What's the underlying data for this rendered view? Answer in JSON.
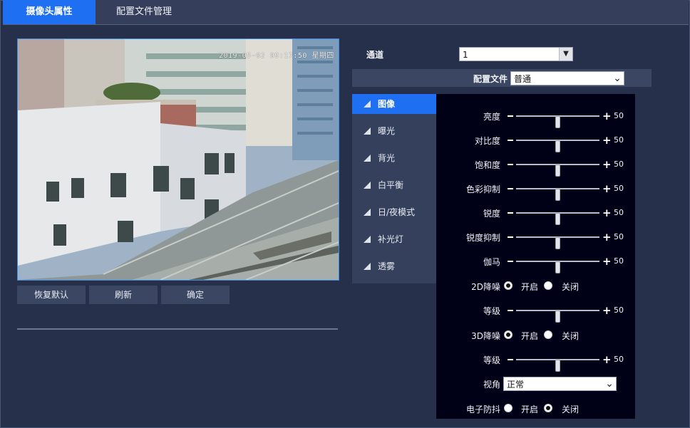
{
  "tabs": [
    {
      "label": "摄像头属性",
      "active": true
    },
    {
      "label": "配置文件管理",
      "active": false
    }
  ],
  "video": {
    "timestamp": "2019-05-02 09:17:50 星期四"
  },
  "buttons": {
    "restore": "恢复默认",
    "refresh": "刷新",
    "confirm": "确定"
  },
  "channel": {
    "label": "通道",
    "value": "1"
  },
  "profile": {
    "label": "配置文件",
    "value": "普通"
  },
  "nav": [
    {
      "label": "图像",
      "active": true
    },
    {
      "label": "曝光",
      "active": false
    },
    {
      "label": "背光",
      "active": false
    },
    {
      "label": "白平衡",
      "active": false
    },
    {
      "label": "日/夜模式",
      "active": false
    },
    {
      "label": "补光灯",
      "active": false
    },
    {
      "label": "透雾",
      "active": false
    }
  ],
  "sliders": {
    "brightness": {
      "label": "亮度",
      "value": 50
    },
    "contrast": {
      "label": "对比度",
      "value": 50
    },
    "saturation": {
      "label": "饱和度",
      "value": 50
    },
    "chroma_suppress": {
      "label": "色彩抑制",
      "value": 50
    },
    "sharpness": {
      "label": "锐度",
      "value": 50
    },
    "sharp_suppress": {
      "label": "锐度抑制",
      "value": 50
    },
    "gamma": {
      "label": "伽马",
      "value": 50
    },
    "nr2d_level": {
      "label": "等级",
      "value": 50
    },
    "nr3d_level": {
      "label": "等级",
      "value": 50
    }
  },
  "radios": {
    "nr2d": {
      "label": "2D降噪",
      "on_label": "开启",
      "off_label": "关闭",
      "selected": "on"
    },
    "nr3d": {
      "label": "3D降噪",
      "on_label": "开启",
      "off_label": "关闭",
      "selected": "on"
    },
    "eis": {
      "label": "电子防抖",
      "on_label": "开启",
      "off_label": "关闭",
      "selected": "off"
    }
  },
  "view": {
    "label": "视角",
    "value": "正常"
  },
  "colors": {
    "accent": "#1f6ff2",
    "background": "#26304a",
    "panel": "#000016"
  }
}
